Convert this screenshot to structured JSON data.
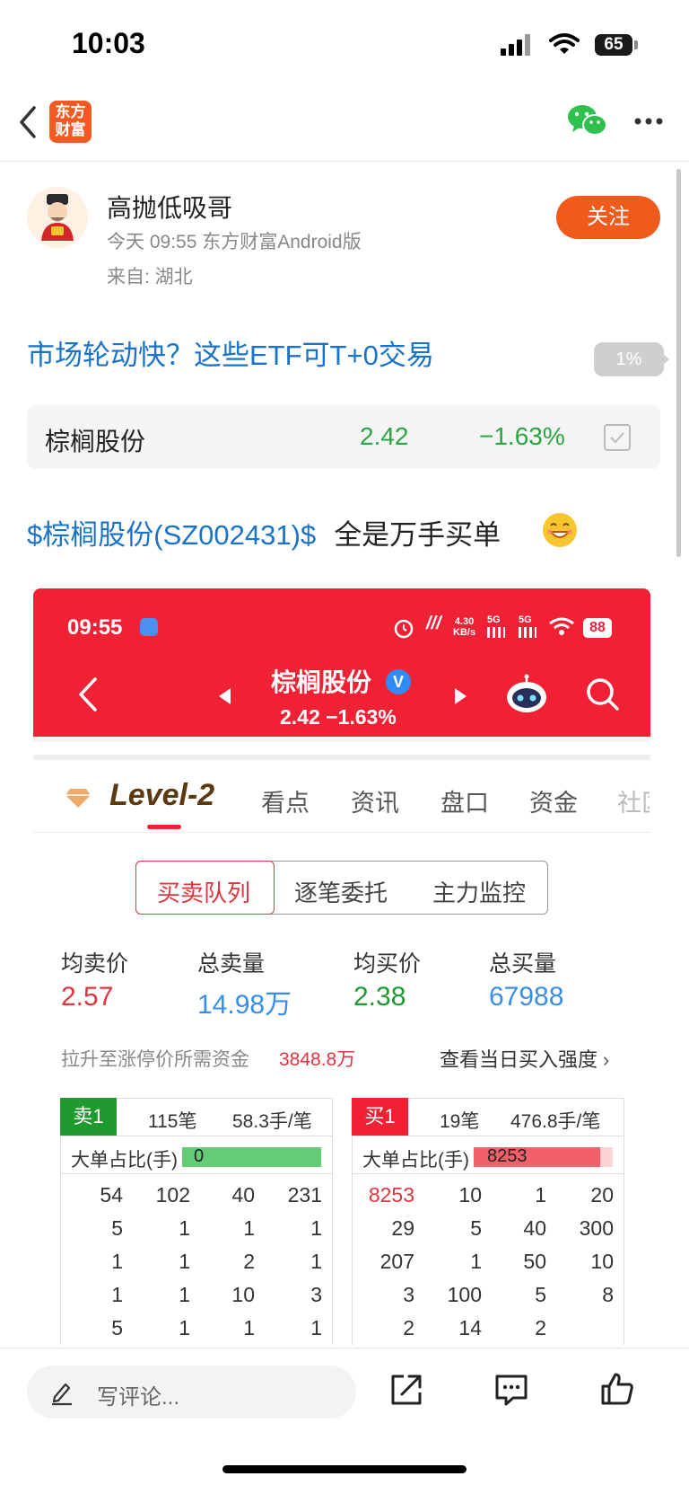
{
  "status_bar": {
    "time": "10:03",
    "battery": "65"
  },
  "nav": {
    "logo_text": "东方财富"
  },
  "post": {
    "author": "高抛低吸哥",
    "meta": "今天 09:55 东方财富Android版",
    "location": "来自: 湖北",
    "follow_label": "关注",
    "title": "市场轮动快？这些ETF可T+0交易",
    "progress": "1%",
    "stock_card": {
      "name": "棕榈股份",
      "price": "2.42",
      "change": "−1.63%"
    },
    "body_link": "$棕榈股份(SZ002431)$",
    "body_text": "全是万手买单"
  },
  "screenshot": {
    "time": "09:55",
    "network_speed": [
      "4.30",
      "KB/s"
    ],
    "signal_labels": [
      "5G",
      "5G"
    ],
    "battery": "88",
    "stock_name": "棕榈股份",
    "stock_price_line": "2.42  −1.63%",
    "verified": "V",
    "tabs": [
      "Level-2",
      "看点",
      "资讯",
      "盘口",
      "资金",
      "社区"
    ],
    "segments": [
      "买卖队列",
      "逐笔委托",
      "主力监控"
    ],
    "stats": [
      {
        "label": "均卖价",
        "value": "2.57",
        "color": "#e0343f"
      },
      {
        "label": "总卖量",
        "value": "14.98万",
        "color": "#3a8ee6"
      },
      {
        "label": "均买价",
        "value": "2.38",
        "color": "#1e9a2e"
      },
      {
        "label": "总买量",
        "value": "67988",
        "color": "#3a8ee6"
      }
    ],
    "raise_label": "拉升至涨停价所需资金",
    "raise_value": "3848.8万",
    "buy_strength_label": "查看当日买入强度",
    "sell_table": {
      "badge": "卖1",
      "count": "115笔",
      "avg": "58.3手/笔",
      "big_order_label": "大单占比(手)",
      "big_order_value": "0",
      "big_order_ratio": 1.0,
      "rows": [
        [
          "54",
          "102",
          "40",
          "231"
        ],
        [
          "5",
          "1",
          "1",
          "1"
        ],
        [
          "1",
          "1",
          "2",
          "1"
        ],
        [
          "1",
          "1",
          "10",
          "3"
        ],
        [
          "5",
          "1",
          "1",
          "1"
        ]
      ]
    },
    "buy_table": {
      "badge": "买1",
      "count": "19笔",
      "avg": "476.8手/笔",
      "big_order_label": "大单占比(手)",
      "big_order_value": "8253",
      "big_order_ratio": 0.91,
      "rows": [
        [
          "8253",
          "10",
          "1",
          "20"
        ],
        [
          "29",
          "5",
          "40",
          "300"
        ],
        [
          "207",
          "1",
          "50",
          "10"
        ],
        [
          "3",
          "100",
          "5",
          "8"
        ],
        [
          "2",
          "14",
          "2",
          ""
        ]
      ]
    }
  },
  "bottom_bar": {
    "comment_placeholder": "写评论..."
  }
}
